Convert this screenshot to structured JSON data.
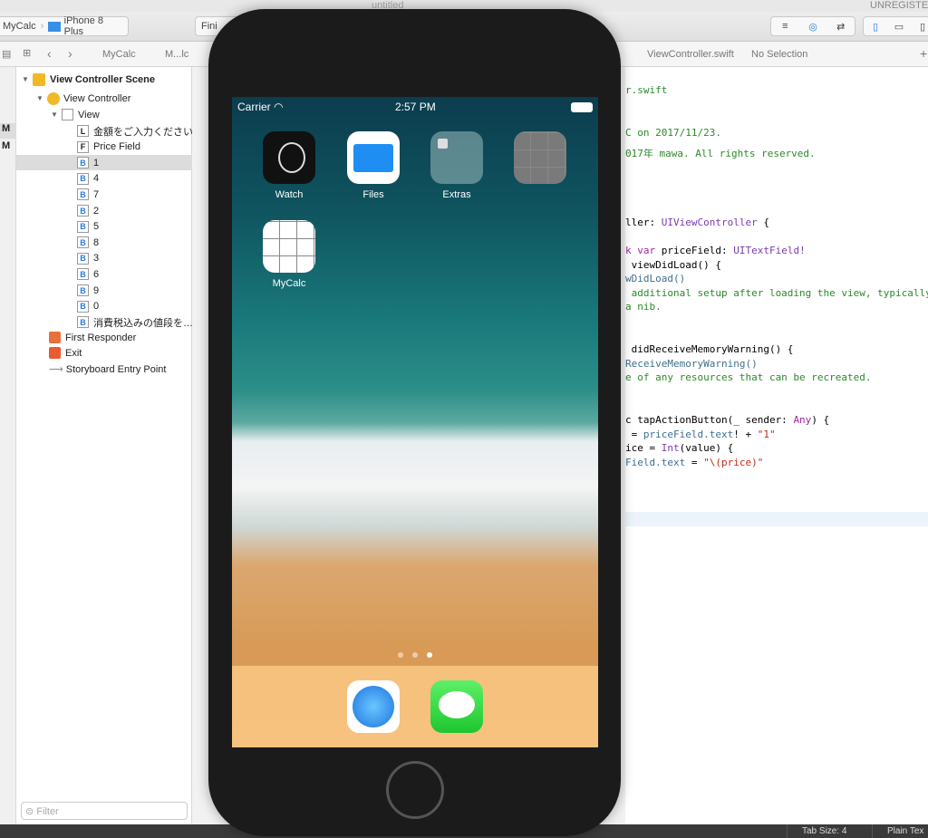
{
  "window": {
    "title": "untitled",
    "registration": "UNREGISTE"
  },
  "toolbar": {
    "scheme": "MyCalc",
    "device": "iPhone 8 Plus",
    "activity": "Fini"
  },
  "jumpbar": {
    "left": [
      "MyCalc",
      "M...lc"
    ],
    "file": "ViewController.swift",
    "selection": "No Selection"
  },
  "navstrip": {
    "items": [
      "M",
      "M"
    ]
  },
  "outline": {
    "scene": "View Controller Scene",
    "controller": "View Controller",
    "view": "View",
    "children": [
      {
        "badge": "L",
        "label": "金額をご入力ください"
      },
      {
        "badge": "F",
        "label": "Price Field"
      },
      {
        "badge": "B",
        "label": "1",
        "selected": true
      },
      {
        "badge": "B",
        "label": "4"
      },
      {
        "badge": "B",
        "label": "7"
      },
      {
        "badge": "B",
        "label": "2"
      },
      {
        "badge": "B",
        "label": "5"
      },
      {
        "badge": "B",
        "label": "8"
      },
      {
        "badge": "B",
        "label": "3"
      },
      {
        "badge": "B",
        "label": "6"
      },
      {
        "badge": "B",
        "label": "9"
      },
      {
        "badge": "B",
        "label": "0"
      },
      {
        "badge": "B",
        "label": "消費税込みの値段を…"
      }
    ],
    "first_responder": "First Responder",
    "exit": "Exit",
    "entry": "Storyboard Entry Point",
    "filter_placeholder": "Filter"
  },
  "code": {
    "l1": "r.swift",
    "l2": "C on 2017/11/23.",
    "l3": "017年 mawa. All rights reserved.",
    "l4a": "ller: ",
    "l4b": "UIViewController",
    "l4c": " {",
    "l5a": "k var",
    "l5b": " priceField: ",
    "l5c": "UITextField!",
    "l6": " viewDidLoad() {",
    "l7": "wDidLoad()",
    "l8": " additional setup after loading the view, typically",
    "l9": "a nib.",
    "l10": " didReceiveMemoryWarning() {",
    "l11": "ReceiveMemoryWarning()",
    "l12": "e of any resources that can be recreated.",
    "l13a": "c tapActionButton(_ sender: ",
    "l13b": "Any",
    "l13c": ") {",
    "l14a": " = ",
    "l14b": "priceField.text",
    "l14c": "! + ",
    "l14d": "\"1\"",
    "l15a": "ice = ",
    "l15b": "Int",
    "l15c": "(value) {",
    "l16a": "Field.text",
    "l16b": " = ",
    "l16c": "\"\\(price)\""
  },
  "status": {
    "tab_size": "Tab Size: 4",
    "mode": "Plain Tex"
  },
  "simulator": {
    "carrier": "Carrier",
    "time": "2:57 PM",
    "apps": [
      {
        "label": "Watch"
      },
      {
        "label": "Files"
      },
      {
        "label": "Extras"
      },
      {
        "label": ""
      },
      {
        "label": "MyCalc"
      }
    ],
    "page_count": 3,
    "current_page": 3,
    "dock": [
      "safari-icon",
      "messages-icon"
    ]
  }
}
